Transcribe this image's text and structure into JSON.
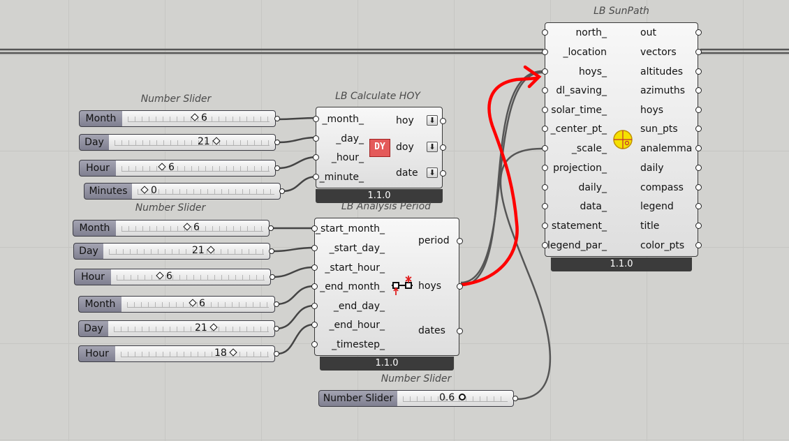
{
  "sliders": [
    {
      "caption": "Number Slider",
      "label": "Month",
      "value": "6"
    },
    {
      "label": "Day",
      "value": "21"
    },
    {
      "label": "Hour",
      "value": "6"
    },
    {
      "label": "Minutes",
      "value": "0"
    },
    {
      "caption": "Number Slider",
      "label": "Month",
      "value": "6"
    },
    {
      "label": "Day",
      "value": "21"
    },
    {
      "label": "Hour",
      "value": "6"
    },
    {
      "label": "Month",
      "value": "6"
    },
    {
      "label": "Day",
      "value": "21"
    },
    {
      "label": "Hour",
      "value": "18"
    },
    {
      "caption": "Number Slider",
      "label": "Number Slider",
      "value": "0.6"
    }
  ],
  "hoy": {
    "title": "LB Calculate HOY",
    "inputs": [
      "_month_",
      "_day_",
      "_hour_",
      "_minute_"
    ],
    "outputs": [
      "hoy",
      "doy",
      "date"
    ],
    "version": "1.1.0"
  },
  "period": {
    "title": "LB Analysis Period",
    "inputs": [
      "_start_month_",
      "_start_day_",
      "_start_hour_",
      "_end_month_",
      "_end_day_",
      "_end_hour_",
      "_timestep_"
    ],
    "outputs": [
      "period",
      "hoys",
      "dates"
    ],
    "version": "1.1.0"
  },
  "sunpath": {
    "title": "LB SunPath",
    "inputs": [
      "north_",
      "_location",
      "hoys_",
      "dl_saving_",
      "solar_time_",
      "_center_pt_",
      "_scale_",
      "projection_",
      "daily_",
      "data_",
      "statement_",
      "legend_par_"
    ],
    "outputs": [
      "out",
      "vectors",
      "altitudes",
      "azimuths",
      "hoys",
      "sun_pts",
      "analemma",
      "daily",
      "compass",
      "legend",
      "title",
      "color_pts"
    ],
    "version": "1.1.0"
  },
  "colors": {
    "annotation": "#ff0000",
    "wire": "#555555",
    "footer": "#3b3b3b"
  }
}
